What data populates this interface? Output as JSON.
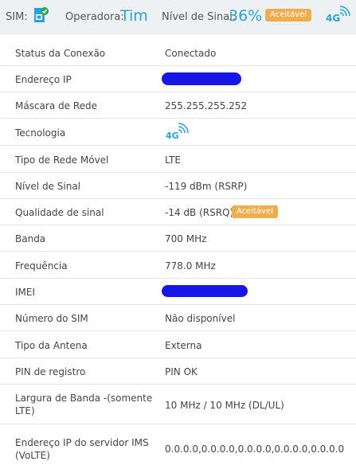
{
  "topbar": {
    "sim_label": "SIM:",
    "operator_label": "Operadora:",
    "operator_value": "Tim",
    "signal_label": "Nível de Sinal:",
    "signal_value": "36%",
    "signal_badge": "Aceitável",
    "network_icon_text": "4G"
  },
  "rows": [
    {
      "label": "Status da Conexão",
      "value": "Conectado"
    },
    {
      "label": "Endereço IP",
      "value": ""
    },
    {
      "label": "Máscara de Rede",
      "value": "255.255.255.252"
    },
    {
      "label": "Tecnologia",
      "value": "4G"
    },
    {
      "label": "Tipo de Rede Móvel",
      "value": "LTE"
    },
    {
      "label": "Nível de Sinal",
      "value": "-119 dBm (RSRP)"
    },
    {
      "label": "Qualidade de sinal",
      "value": "-14 dB (RSRQ)",
      "badge": "Aceitável"
    },
    {
      "label": "Banda",
      "value": "700 MHz"
    },
    {
      "label": "Frequência",
      "value": "778.0 MHz"
    },
    {
      "label": "IMEI",
      "value": ""
    },
    {
      "label": "Número do SIM",
      "value": "Não disponível"
    },
    {
      "label": "Tipo da Antena",
      "value": "Externa"
    },
    {
      "label": "PIN de registro",
      "value": "PIN OK"
    },
    {
      "label": "Largura de Banda -(somente LTE)",
      "value": "10 MHz / 10 MHz (DL/UL)"
    },
    {
      "label": "Endereço IP do servidor IMS (VoLTE)",
      "value": "0.0.0.0,0.0.0.0,0.0.0.0,0.0.0.0,0.0.0.0"
    }
  ],
  "colors": {
    "accent": "#2aa1d8",
    "badge": "#f0ad4e",
    "sim_icon_green": "#22a84a",
    "redaction": "#1616e6"
  }
}
